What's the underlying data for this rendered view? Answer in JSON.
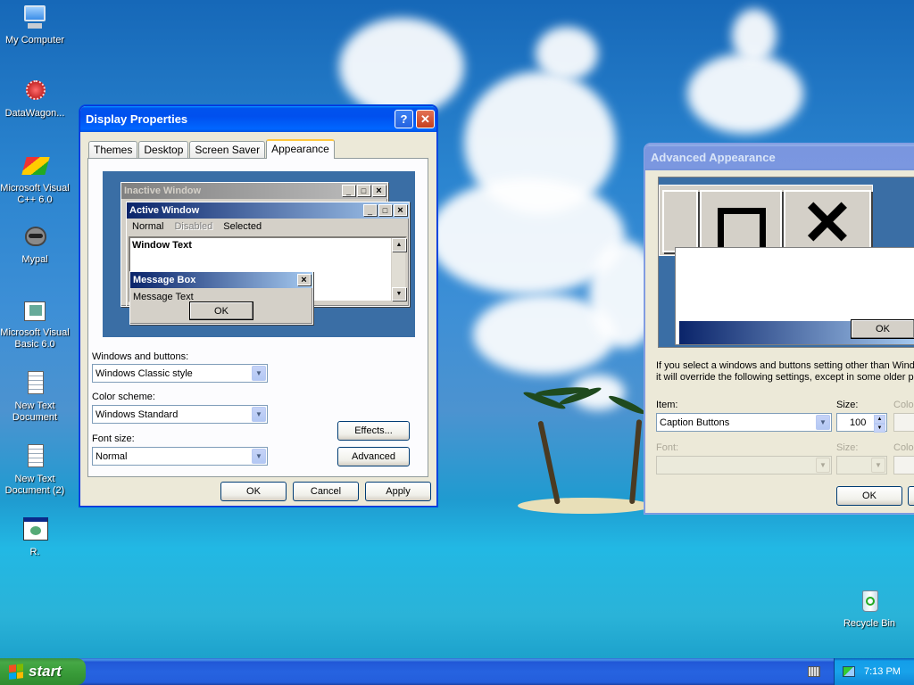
{
  "desktop": {
    "icons": [
      {
        "label": "My Computer"
      },
      {
        "label": "DataWagon..."
      },
      {
        "label": "Microsoft Visual C++ 6.0"
      },
      {
        "label": "Mypal"
      },
      {
        "label": "Microsoft Visual Basic 6.0"
      },
      {
        "label": "New Text Document"
      },
      {
        "label": "New Text Document (2)"
      },
      {
        "label": "R."
      },
      {
        "label": "Recycle Bin"
      }
    ]
  },
  "display_properties": {
    "title": "Display Properties",
    "help_glyph": "?",
    "close_glyph": "✕",
    "tabs": [
      {
        "label": "Themes"
      },
      {
        "label": "Desktop"
      },
      {
        "label": "Screen Saver"
      },
      {
        "label": "Appearance"
      }
    ],
    "preview": {
      "inactive_title": "Inactive Window",
      "active_title": "Active Window",
      "menu_normal": "Normal",
      "menu_disabled": "Disabled",
      "menu_selected": "Selected",
      "window_text": "Window Text",
      "msgbox_title": "Message Box",
      "msgbox_text": "Message Text",
      "msgbox_ok": "OK"
    },
    "windows_buttons_label": "Windows and buttons:",
    "windows_buttons_value": "Windows Classic style",
    "color_scheme_label": "Color scheme:",
    "color_scheme_value": "Windows Standard",
    "font_size_label": "Font size:",
    "font_size_value": "Normal",
    "effects_button": "Effects...",
    "advanced_button": "Advanced",
    "ok_button": "OK",
    "cancel_button": "Cancel",
    "apply_button": "Apply"
  },
  "advanced_appearance": {
    "title": "Advanced Appearance",
    "preview_ok": "OK",
    "desc_line1": "If you select a windows and buttons setting other than Wind",
    "desc_line2": "it will override the following settings, except in some older pr",
    "item_label": "Item:",
    "item_value": "Caption Buttons",
    "size_label": "Size:",
    "size_value": "100",
    "color_label": "Color",
    "font_label": "Font:",
    "font_size_label": "Size:",
    "font_color_label": "Color",
    "ok_button": "OK"
  },
  "taskbar": {
    "start_label": "start",
    "clock": "7:13 PM"
  }
}
